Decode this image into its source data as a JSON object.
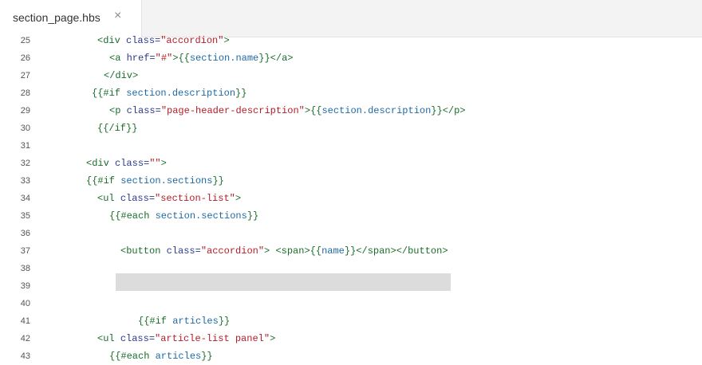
{
  "tab": {
    "title": "section_page.hbs",
    "close_glyph": "×"
  },
  "colors": {
    "tag": "#196d2a",
    "attribute": "#2b3a8c",
    "string": "#b31d28",
    "variable": "#1f6aa5",
    "selection": "#dcdcdc"
  },
  "editor": {
    "lines": [
      {
        "n": "25",
        "segs": [
          {
            "t": "t",
            "v": "<div "
          },
          {
            "t": "a",
            "v": "class="
          },
          {
            "t": "s",
            "v": "\"accordion\""
          },
          {
            "t": "t",
            "v": ">"
          }
        ]
      },
      {
        "n": "26",
        "segs": [
          {
            "t": "t",
            "v": "<a "
          },
          {
            "t": "a",
            "v": "href="
          },
          {
            "t": "s",
            "v": "\"#\""
          },
          {
            "t": "t",
            "v": ">"
          },
          {
            "t": "t",
            "v": "{{"
          },
          {
            "t": "v",
            "v": "section.name"
          },
          {
            "t": "t",
            "v": "}}"
          },
          {
            "t": "t",
            "v": "</a>"
          }
        ]
      },
      {
        "n": "27",
        "segs": [
          {
            "t": "t",
            "v": "</div>"
          }
        ]
      },
      {
        "n": "28",
        "segs": [
          {
            "t": "t",
            "v": "{{#if "
          },
          {
            "t": "v",
            "v": "section.description"
          },
          {
            "t": "t",
            "v": "}}"
          }
        ]
      },
      {
        "n": "29",
        "segs": [
          {
            "t": "t",
            "v": "<p "
          },
          {
            "t": "a",
            "v": "class="
          },
          {
            "t": "s",
            "v": "\"page-header-description\""
          },
          {
            "t": "t",
            "v": ">"
          },
          {
            "t": "t",
            "v": "{{"
          },
          {
            "t": "v",
            "v": "section.description"
          },
          {
            "t": "t",
            "v": "}}"
          },
          {
            "t": "t",
            "v": "</p>"
          }
        ]
      },
      {
        "n": "30",
        "segs": [
          {
            "t": "t",
            "v": "{{/if}}"
          }
        ]
      },
      {
        "n": "31",
        "segs": []
      },
      {
        "n": "32",
        "segs": [
          {
            "t": "t",
            "v": "<div "
          },
          {
            "t": "a",
            "v": "class="
          },
          {
            "t": "s",
            "v": "\"\""
          },
          {
            "t": "t",
            "v": ">"
          }
        ]
      },
      {
        "n": "33",
        "segs": [
          {
            "t": "t",
            "v": "{{#if "
          },
          {
            "t": "v",
            "v": "section.sections"
          },
          {
            "t": "t",
            "v": "}}"
          }
        ]
      },
      {
        "n": "34",
        "segs": [
          {
            "t": "t",
            "v": "<ul "
          },
          {
            "t": "a",
            "v": "class="
          },
          {
            "t": "s",
            "v": "\"section-list\""
          },
          {
            "t": "t",
            "v": ">"
          }
        ]
      },
      {
        "n": "35",
        "segs": [
          {
            "t": "t",
            "v": "{{#each "
          },
          {
            "t": "v",
            "v": "section.sections"
          },
          {
            "t": "t",
            "v": "}}"
          }
        ]
      },
      {
        "n": "36",
        "segs": []
      },
      {
        "n": "37",
        "segs": [
          {
            "t": "t",
            "v": "<button "
          },
          {
            "t": "a",
            "v": "class="
          },
          {
            "t": "s",
            "v": "\"accordion\""
          },
          {
            "t": "t",
            "v": "> "
          },
          {
            "t": "t",
            "v": "<span>"
          },
          {
            "t": "t",
            "v": "{{"
          },
          {
            "t": "v",
            "v": "name"
          },
          {
            "t": "t",
            "v": "}}"
          },
          {
            "t": "t",
            "v": "</span></button>"
          }
        ]
      },
      {
        "n": "38",
        "segs": []
      },
      {
        "n": "39",
        "segs": []
      },
      {
        "n": "40",
        "segs": []
      },
      {
        "n": "41",
        "segs": [
          {
            "t": "t",
            "v": "{{#if "
          },
          {
            "t": "v",
            "v": "articles"
          },
          {
            "t": "t",
            "v": "}}"
          }
        ]
      },
      {
        "n": "42",
        "segs": [
          {
            "t": "t",
            "v": "<ul "
          },
          {
            "t": "a",
            "v": "class="
          },
          {
            "t": "s",
            "v": "\"article-list panel\""
          },
          {
            "t": "t",
            "v": ">"
          }
        ]
      },
      {
        "n": "43",
        "segs": [
          {
            "t": "t",
            "v": "{{#each "
          },
          {
            "t": "v",
            "v": "articles"
          },
          {
            "t": "t",
            "v": "}}"
          }
        ]
      }
    ]
  }
}
